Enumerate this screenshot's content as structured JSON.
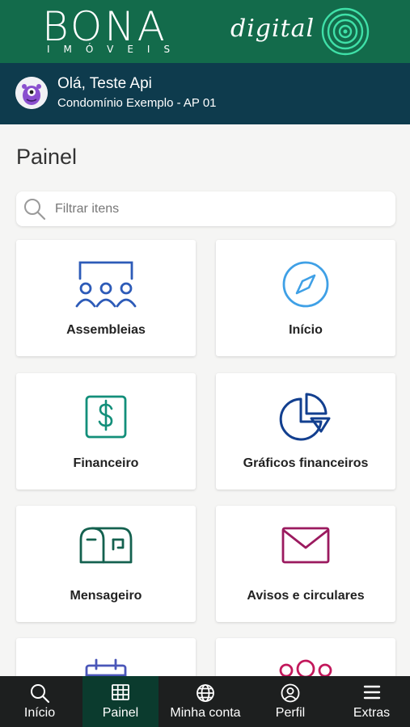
{
  "brand": {
    "name": "BONA",
    "sub": "IMÓVEIS",
    "digital": "digital"
  },
  "user": {
    "greeting": "Olá, Teste Api",
    "unit": "Condomínio Exemplo - AP 01"
  },
  "page": {
    "title": "Painel"
  },
  "search": {
    "placeholder": "Filtrar itens",
    "value": ""
  },
  "cards": [
    {
      "label": "Assembleias",
      "icon": "assembly-icon",
      "color": "#2d5bb8"
    },
    {
      "label": "Início",
      "icon": "compass-icon",
      "color": "#3fa0e6"
    },
    {
      "label": "Financeiro",
      "icon": "dollar-icon",
      "color": "#138f7a"
    },
    {
      "label": "Gráficos financeiros",
      "icon": "pie-chart-icon",
      "color": "#123f8f"
    },
    {
      "label": "Mensageiro",
      "icon": "mailbox-icon",
      "color": "#14614f"
    },
    {
      "label": "Avisos e circulares",
      "icon": "envelope-icon",
      "color": "#9b1a5f"
    },
    {
      "label": "",
      "icon": "calendar-icon",
      "color": "#4a56b8"
    },
    {
      "label": "",
      "icon": "group-icon",
      "color": "#c2185b"
    }
  ],
  "tabs": [
    {
      "label": "Início",
      "icon": "search-icon",
      "active": false
    },
    {
      "label": "Painel",
      "icon": "grid-icon",
      "active": true
    },
    {
      "label": "Minha conta",
      "icon": "globe-icon",
      "active": false
    },
    {
      "label": "Perfil",
      "icon": "user-circle-icon",
      "active": false
    },
    {
      "label": "Extras",
      "icon": "menu-icon",
      "active": false
    }
  ],
  "colors": {
    "brand_green": "#136b4b",
    "user_bar": "#0e3b4d",
    "tab_bar": "#1d1f1f",
    "tab_active": "#0b3b2e"
  }
}
